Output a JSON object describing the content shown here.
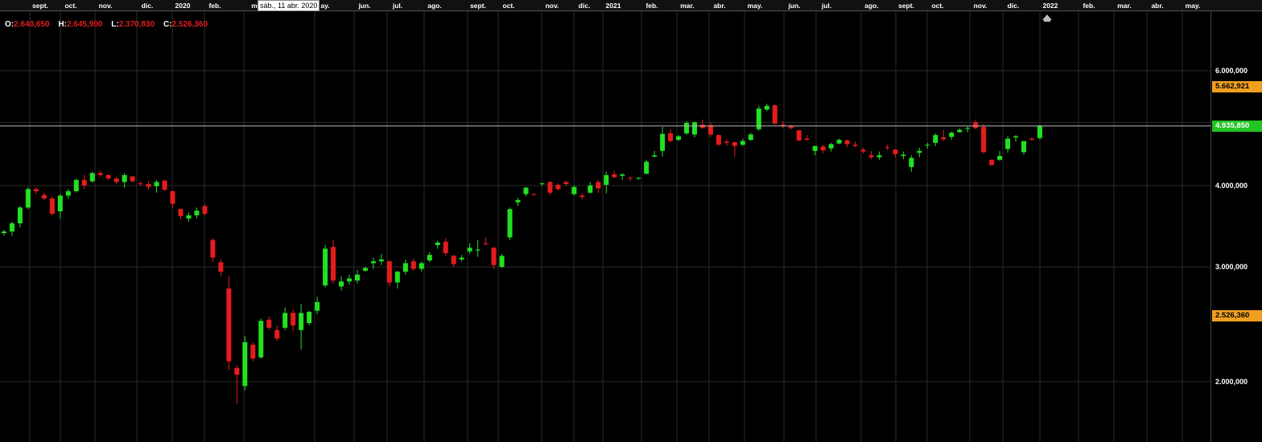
{
  "ohlc_bar": {
    "o_label": "O:",
    "o_value": "2.640,650",
    "h_label": "H:",
    "h_value": "2.645,900",
    "l_label": "L:",
    "l_value": "2.370,830",
    "c_label": "C:",
    "c_value": "2.526,360"
  },
  "tooltip": "sáb., 11 abr. 2020",
  "badges": {
    "high": {
      "text": "5.662,921",
      "value": 5662.921,
      "color": "#f0a020"
    },
    "last": {
      "text": "4.935,850",
      "value": 4935.85,
      "color": "#22c422"
    },
    "low": {
      "text": "2.526,360",
      "value": 2526.36,
      "color": "#f0a020"
    }
  },
  "colors": {
    "up": "#22e022",
    "down": "#e51c1c",
    "grid": "#2a2a2a",
    "background": "#000000"
  },
  "icons": {
    "scroll_end": "home-arrow-icon"
  },
  "chart_data": {
    "type": "candlestick",
    "x_axis_labels": [
      "sept.",
      "oct.",
      "nov.",
      "dic.",
      "2020",
      "feb.",
      "m",
      "ay.",
      "jun.",
      "jul.",
      "ago.",
      "sept.",
      "oct.",
      "nov.",
      "dic.",
      "2021",
      "feb.",
      "mar.",
      "abr.",
      "may.",
      "jun.",
      "jul.",
      "ago.",
      "sept.",
      "oct.",
      "nov.",
      "dic.",
      "2022",
      "feb.",
      "mar.",
      "abr.",
      "may."
    ],
    "y_ticks": [
      {
        "label": "6.000,000",
        "value": 6000
      },
      {
        "label": "4.000,000",
        "value": 4000
      },
      {
        "label": "3.000,000",
        "value": 3000
      },
      {
        "label": "2.000,000",
        "value": 2000
      }
    ],
    "y_scale": "log",
    "ylim": [
      1500,
      7200
    ],
    "weekly_ohlc": [
      [
        3380,
        3420,
        3350,
        3400
      ],
      [
        3400,
        3520,
        3350,
        3500
      ],
      [
        3500,
        3720,
        3450,
        3700
      ],
      [
        3700,
        3980,
        3680,
        3950
      ],
      [
        3950,
        3980,
        3880,
        3920
      ],
      [
        3870,
        3900,
        3800,
        3820
      ],
      [
        3820,
        3850,
        3600,
        3620
      ],
      [
        3650,
        3880,
        3560,
        3860
      ],
      [
        3860,
        3950,
        3820,
        3920
      ],
      [
        3920,
        4100,
        3900,
        4080
      ],
      [
        4080,
        4150,
        3950,
        4000
      ],
      [
        4060,
        4200,
        4040,
        4180
      ],
      [
        4180,
        4220,
        4120,
        4150
      ],
      [
        4150,
        4160,
        4080,
        4100
      ],
      [
        4100,
        4120,
        4020,
        4050
      ],
      [
        4050,
        4180,
        3970,
        4150
      ],
      [
        4130,
        4140,
        4040,
        4060
      ],
      [
        4030,
        4060,
        3990,
        4020
      ],
      [
        4020,
        4060,
        3940,
        3980
      ],
      [
        3990,
        4080,
        3900,
        4050
      ],
      [
        4070,
        4080,
        3920,
        3940
      ],
      [
        3920,
        3930,
        3700,
        3750
      ],
      [
        3680,
        3690,
        3550,
        3590
      ],
      [
        3560,
        3640,
        3520,
        3600
      ],
      [
        3600,
        3700,
        3560,
        3660
      ],
      [
        3720,
        3750,
        3600,
        3620
      ],
      [
        3300,
        3320,
        3050,
        3100
      ],
      [
        3050,
        3080,
        2900,
        2950
      ],
      [
        2780,
        2900,
        2080,
        2150
      ],
      [
        2100,
        2120,
        1850,
        2050
      ],
      [
        1970,
        2350,
        1940,
        2300
      ],
      [
        2280,
        2300,
        2150,
        2170
      ],
      [
        2180,
        2500,
        2170,
        2480
      ],
      [
        2490,
        2520,
        2400,
        2420
      ],
      [
        2400,
        2440,
        2310,
        2330
      ],
      [
        2420,
        2600,
        2400,
        2550
      ],
      [
        2550,
        2580,
        2390,
        2440
      ],
      [
        2400,
        2630,
        2240,
        2550
      ],
      [
        2460,
        2570,
        2440,
        2560
      ],
      [
        2570,
        2700,
        2540,
        2650
      ],
      [
        2810,
        3240,
        2790,
        3200
      ],
      [
        3220,
        3300,
        2830,
        2860
      ],
      [
        2800,
        2900,
        2760,
        2850
      ],
      [
        2850,
        2920,
        2820,
        2880
      ],
      [
        2860,
        2970,
        2830,
        2920
      ],
      [
        2960,
        3000,
        2950,
        2990
      ],
      [
        3040,
        3100,
        2980,
        3060
      ],
      [
        3060,
        3140,
        3020,
        3080
      ],
      [
        3060,
        3070,
        2800,
        2840
      ],
      [
        2840,
        2960,
        2780,
        2950
      ],
      [
        2950,
        3080,
        2920,
        3040
      ],
      [
        3060,
        3090,
        2960,
        2980
      ],
      [
        2980,
        3060,
        2950,
        3040
      ],
      [
        3070,
        3160,
        3050,
        3130
      ],
      [
        3240,
        3290,
        3200,
        3270
      ],
      [
        3280,
        3320,
        3120,
        3150
      ],
      [
        3120,
        3130,
        3000,
        3030
      ],
      [
        3080,
        3130,
        3060,
        3100
      ],
      [
        3170,
        3260,
        3140,
        3210
      ],
      [
        3180,
        3300,
        3110,
        3190
      ],
      [
        3260,
        3330,
        3240,
        3250
      ],
      [
        3210,
        3220,
        2980,
        3020
      ],
      [
        3000,
        3140,
        2990,
        3120
      ],
      [
        3330,
        3700,
        3300,
        3680
      ],
      [
        3770,
        3830,
        3720,
        3800
      ],
      [
        3880,
        3980,
        3850,
        3970
      ],
      [
        3880,
        3890,
        3860,
        3870
      ],
      [
        4020,
        4040,
        4000,
        4030
      ],
      [
        4050,
        4060,
        3870,
        3900
      ],
      [
        4010,
        4030,
        3930,
        3950
      ],
      [
        4050,
        4070,
        4000,
        4020
      ],
      [
        3880,
        4000,
        3860,
        3980
      ],
      [
        3860,
        3890,
        3810,
        3840
      ],
      [
        3900,
        4050,
        3890,
        4000
      ],
      [
        4050,
        4080,
        3900,
        3960
      ],
      [
        4010,
        4200,
        3890,
        4150
      ],
      [
        4160,
        4210,
        4100,
        4120
      ],
      [
        4140,
        4180,
        4080,
        4160
      ],
      [
        4110,
        4130,
        4060,
        4100
      ],
      [
        4100,
        4120,
        4080,
        4110
      ],
      [
        4170,
        4380,
        4160,
        4350
      ],
      [
        4430,
        4520,
        4420,
        4450
      ],
      [
        4520,
        4920,
        4430,
        4800
      ],
      [
        4810,
        4880,
        4660,
        4680
      ],
      [
        4700,
        4780,
        4680,
        4760
      ],
      [
        4810,
        5020,
        4780,
        4990
      ],
      [
        4790,
        5010,
        4740,
        5000
      ],
      [
        4960,
        5050,
        4890,
        4900
      ],
      [
        4950,
        5000,
        4750,
        4790
      ],
      [
        4780,
        4790,
        4600,
        4620
      ],
      [
        4670,
        4710,
        4600,
        4650
      ],
      [
        4660,
        4670,
        4430,
        4600
      ],
      [
        4620,
        4720,
        4600,
        4680
      ],
      [
        4700,
        4820,
        4680,
        4790
      ],
      [
        4880,
        5300,
        4850,
        5250
      ],
      [
        5230,
        5340,
        5200,
        5300
      ],
      [
        5310,
        5330,
        4950,
        4980
      ],
      [
        4960,
        5020,
        4900,
        4940
      ],
      [
        4940,
        4960,
        4880,
        4900
      ],
      [
        4860,
        4870,
        4680,
        4690
      ],
      [
        4720,
        4780,
        4690,
        4700
      ],
      [
        4520,
        4580,
        4450,
        4600
      ],
      [
        4590,
        4620,
        4480,
        4530
      ],
      [
        4560,
        4650,
        4510,
        4630
      ],
      [
        4640,
        4720,
        4630,
        4700
      ],
      [
        4690,
        4710,
        4580,
        4630
      ],
      [
        4620,
        4670,
        4580,
        4600
      ],
      [
        4540,
        4570,
        4480,
        4510
      ],
      [
        4450,
        4520,
        4390,
        4420
      ],
      [
        4420,
        4510,
        4380,
        4450
      ],
      [
        4580,
        4620,
        4530,
        4570
      ],
      [
        4540,
        4550,
        4420,
        4470
      ],
      [
        4440,
        4510,
        4390,
        4460
      ],
      [
        4270,
        4450,
        4200,
        4410
      ],
      [
        4490,
        4570,
        4420,
        4520
      ],
      [
        4610,
        4650,
        4560,
        4620
      ],
      [
        4650,
        4810,
        4600,
        4780
      ],
      [
        4740,
        4870,
        4680,
        4710
      ],
      [
        4750,
        4840,
        4700,
        4820
      ],
      [
        4830,
        4890,
        4820,
        4870
      ],
      [
        4900,
        4930,
        4830,
        4900
      ],
      [
        5000,
        5050,
        4880,
        4900
      ],
      [
        4920,
        4970,
        4480,
        4500
      ],
      [
        4380,
        4390,
        4290,
        4300
      ],
      [
        4380,
        4520,
        4360,
        4440
      ],
      [
        4550,
        4760,
        4490,
        4720
      ],
      [
        4740,
        4780,
        4670,
        4760
      ],
      [
        4500,
        4560,
        4460,
        4680
      ],
      [
        4720,
        4740,
        4690,
        4700
      ],
      [
        4730,
        4960,
        4700,
        4935.85
      ]
    ],
    "reference_lines": [
      {
        "label": "4.935,850",
        "value": 4935.85
      }
    ]
  }
}
